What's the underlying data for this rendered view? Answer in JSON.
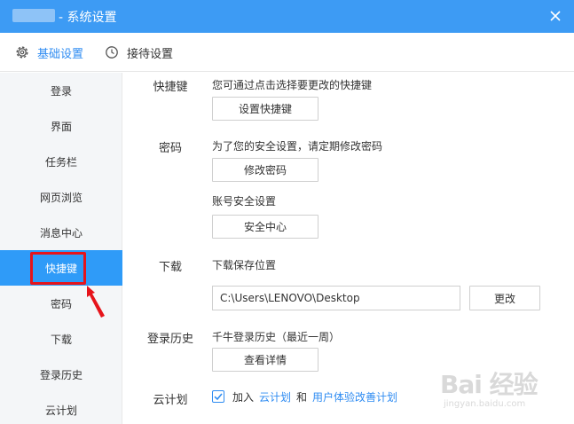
{
  "window": {
    "title": "- 系统设置",
    "close_icon": "close-icon"
  },
  "tabs": [
    {
      "label": "基础设置",
      "icon": "gear-icon",
      "active": true
    },
    {
      "label": "接待设置",
      "icon": "clock-icon",
      "active": false
    }
  ],
  "sidebar": {
    "items": [
      {
        "label": "登录"
      },
      {
        "label": "界面"
      },
      {
        "label": "任务栏"
      },
      {
        "label": "网页浏览"
      },
      {
        "label": "消息中心"
      },
      {
        "label": "快捷键",
        "active": true
      },
      {
        "label": "密码"
      },
      {
        "label": "下载"
      },
      {
        "label": "登录历史"
      },
      {
        "label": "云计划"
      }
    ],
    "annotation": {
      "icon": "red-arrow-icon",
      "color": "#e6141b"
    }
  },
  "content": {
    "shortcut": {
      "label": "快捷键",
      "desc": "您可通过点击选择要更改的快捷键",
      "button": "设置快捷键"
    },
    "password": {
      "label": "密码",
      "desc": "为了您的安全设置，请定期修改密码",
      "button": "修改密码",
      "security_desc": "账号安全设置",
      "security_button": "安全中心"
    },
    "download": {
      "label": "下载",
      "desc": "下载保存位置",
      "path_value": "C:\\Users\\LENOVO\\Desktop",
      "change_button": "更改"
    },
    "history": {
      "label": "登录历史",
      "desc": "千牛登录历史（最近一周）",
      "button": "查看详情"
    },
    "cloud": {
      "label": "云计划",
      "checked": true,
      "join_text": "加入",
      "link1": "云计划",
      "and_text": "和",
      "link2": "用户体验改善计划"
    }
  },
  "watermark": {
    "main": "Bai 经验",
    "sub": "jingyan.baidu.com"
  },
  "colors": {
    "titlebar": "#3d9bf4",
    "accent": "#2f8cf2",
    "active_item": "#2f9bf8",
    "highlight": "#e6141b"
  }
}
